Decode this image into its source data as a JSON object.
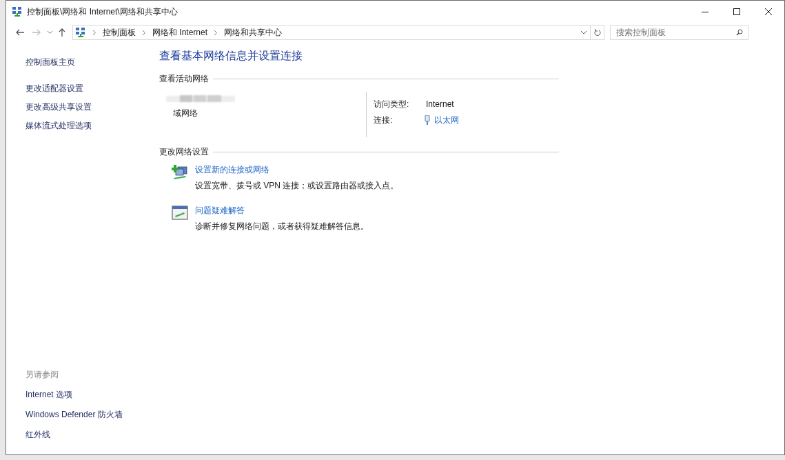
{
  "window": {
    "title": "控制面板\\网络和 Internet\\网络和共享中心"
  },
  "address_bar": {
    "crumbs": [
      "控制面板",
      "网络和 Internet",
      "网络和共享中心"
    ]
  },
  "search": {
    "placeholder": "搜索控制面板"
  },
  "sidebar": {
    "items": [
      "控制面板主页",
      "更改适配器设置",
      "更改高级共享设置",
      "媒体流式处理选项"
    ],
    "see_also": {
      "heading": "另请参阅",
      "items": [
        "Internet 选项",
        "Windows Defender 防火墙",
        "红外线"
      ]
    }
  },
  "main": {
    "heading": "查看基本网络信息并设置连接",
    "active_networks": {
      "heading": "查看活动网络",
      "network_type": "域网络",
      "fields": [
        {
          "label": "访问类型:",
          "value": "Internet",
          "kind": "text"
        },
        {
          "label": "连接:",
          "value": "以太网",
          "kind": "link"
        }
      ]
    },
    "change_settings": {
      "heading": "更改网络设置",
      "tasks": [
        {
          "kind": "new-connection",
          "title": "设置新的连接或网络",
          "description": "设置宽带、拨号或 VPN 连接；或设置路由器或接入点。"
        },
        {
          "kind": "troubleshoot",
          "title": "问题疑难解答",
          "description": "诊断并修复网络问题，或者获得疑难解答信息。"
        }
      ]
    }
  }
}
